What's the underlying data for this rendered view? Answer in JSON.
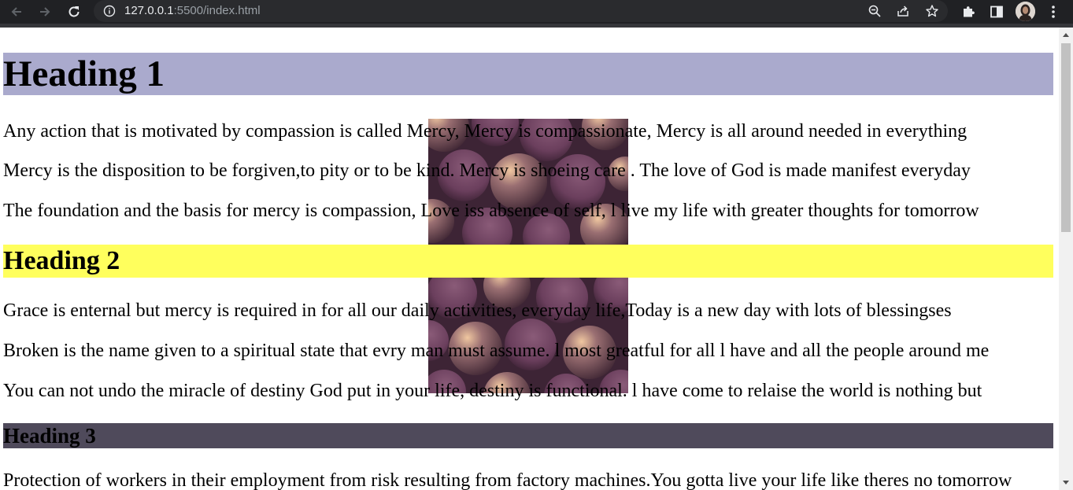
{
  "browser": {
    "url_host": "127.0.0.1",
    "url_rest": ":5500/index.html"
  },
  "page": {
    "heading1": "Heading 1",
    "section1": [
      "Any action that is motivated by compassion is called Mercy, Mercy is compassionate, Mercy is all around needed in everything",
      "Mercy is the disposition to be forgiven,to pity or to be kind. Mercy is shoeing care . The love of God is made manifest everyday",
      "The foundation and the basis for mercy is compassion, Love iss absence of self, l live my life with greater thoughts for tomorrow"
    ],
    "heading2": "Heading 2",
    "section2": [
      "Grace is enternal but mercy is required in for all our daily activities, everyday life,Today is a new day with lots of blessingses",
      "Broken is the name given to a spiritual state that evry man must assume. l most greatful for all l have and all the people around me",
      "You can not undo the miracle of destiny God put in your life, destiny is functional. l have come to relaise the world is nothing but"
    ],
    "heading3": "Heading 3",
    "section3": [
      "Protection of workers in their employment from risk resulting from factory machines.You gotta live your life like theres no tomorrow"
    ]
  },
  "colors": {
    "heading1_bg": "#aaaacd",
    "heading2_bg": "#ffff5d",
    "heading3_bg": "#4f4a5b",
    "chrome_bg": "#202124"
  },
  "icons": {
    "back": "arrow-left-icon",
    "forward": "arrow-right-icon",
    "reload": "reload-icon",
    "site_info": "info-icon",
    "zoom": "zoom-icon",
    "share": "share-icon",
    "bookmark": "star-icon",
    "extensions": "puzzle-icon",
    "side_panel": "side-panel-icon",
    "profile": "avatar",
    "menu": "kebab-menu-icon",
    "background_image": "purple-spheres-image"
  }
}
